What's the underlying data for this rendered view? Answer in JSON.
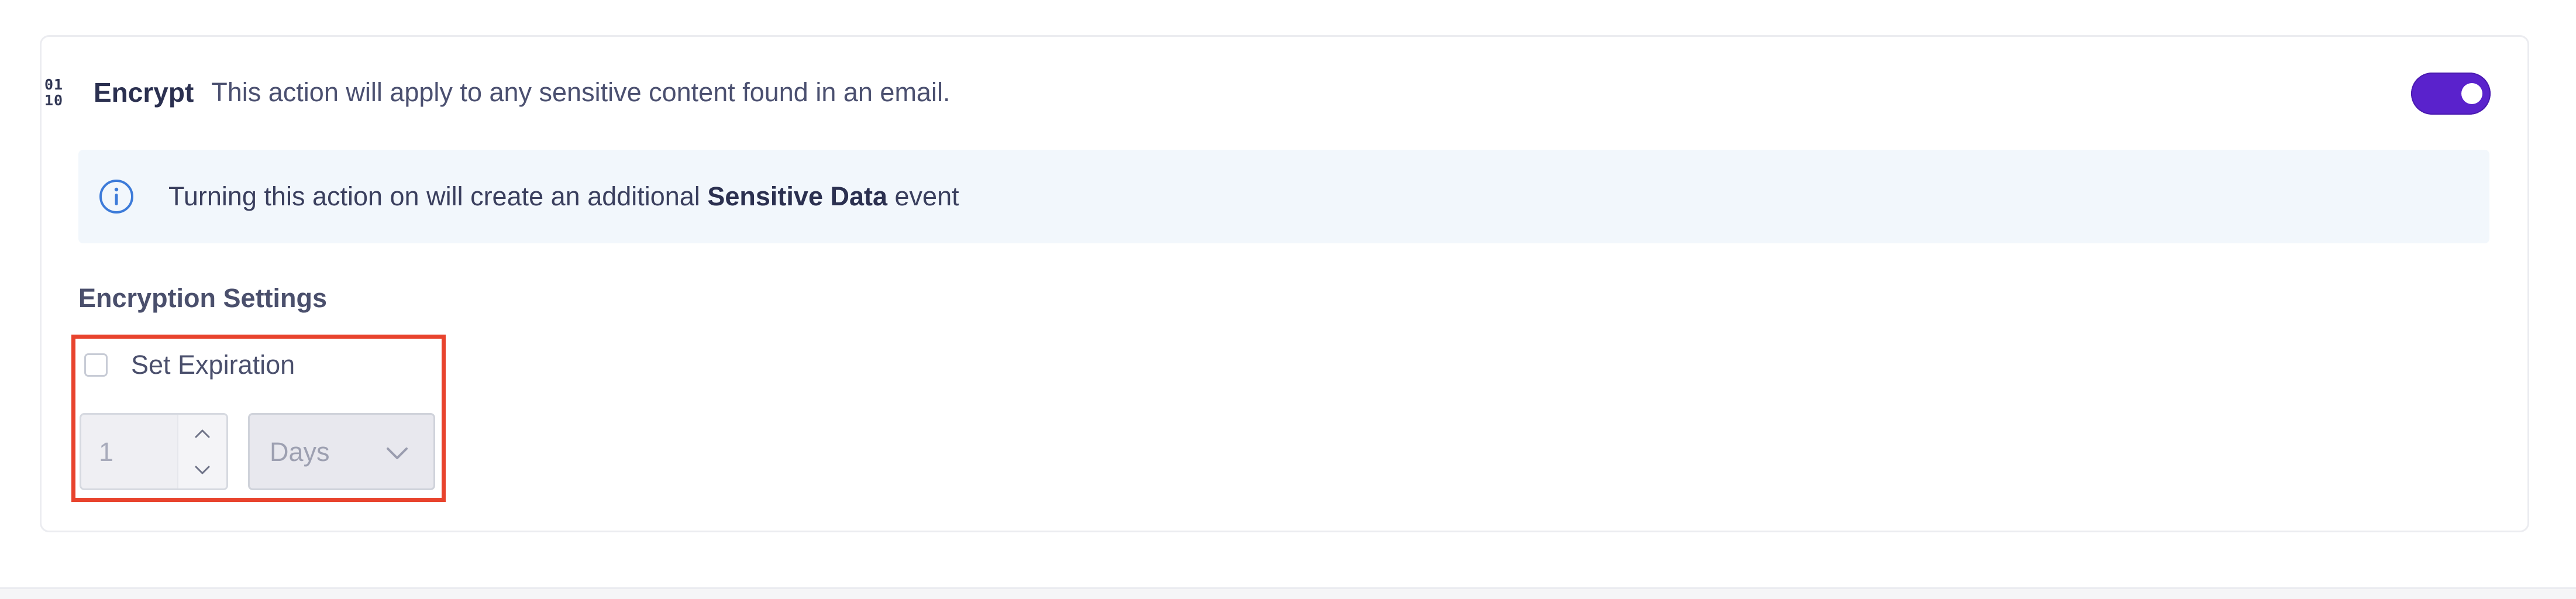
{
  "encrypt_action": {
    "icon": "binary-icon",
    "icon_digits_top": "01",
    "icon_digits_bottom": "10",
    "title": "Encrypt",
    "description": "This action will apply to any sensitive content found in an email.",
    "enabled": true,
    "toggle_color": "#5a22cc"
  },
  "info_banner": {
    "icon": "info-icon",
    "text_before": "Turning this action on will create an additional",
    "text_bold": "Sensitive Data",
    "text_after": "event"
  },
  "encryption_settings": {
    "title": "Encryption Settings",
    "set_expiration_label": "Set Expiration",
    "set_expiration_checked": false,
    "expiration_value": "1",
    "expiration_unit": "Days",
    "highlight_color": "#e8432d"
  }
}
